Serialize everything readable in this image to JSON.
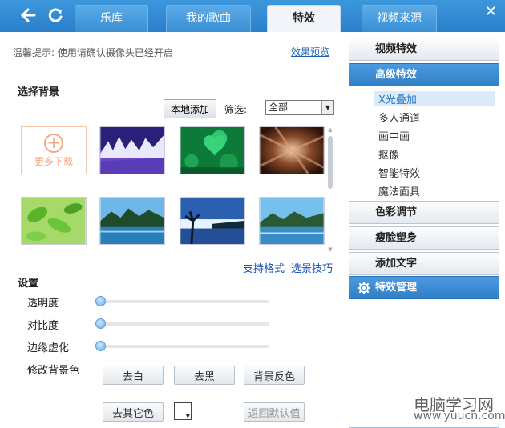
{
  "tabs": [
    {
      "label": "乐库"
    },
    {
      "label": "我的歌曲"
    },
    {
      "label": "特效"
    },
    {
      "label": "视频来源"
    }
  ],
  "icons": {
    "back": "back-arrow-icon",
    "refresh": "refresh-icon",
    "close": "close-icon"
  },
  "tip": "温馨提示: 使用请确认摄像头已经开启",
  "preview_link": "效果预览",
  "background_section": {
    "title": "选择背景",
    "local_add": "本地添加",
    "filter_label": "筛选:",
    "filter_value": "全部",
    "more_download": "更多下载",
    "support_format": "支持格式",
    "bg_tips": "选景技巧"
  },
  "settings": {
    "title": "设置",
    "sliders": [
      {
        "label": "透明度",
        "value": 0
      },
      {
        "label": "对比度",
        "value": 0
      },
      {
        "label": "边缘虚化",
        "value": 0
      }
    ],
    "bg_color_label": "修改背景色",
    "buttons": {
      "remove_white": "去白",
      "remove_black": "去黑",
      "invert_bg": "背景反色",
      "remove_other": "去其它色",
      "restore_default": "返回默认值"
    }
  },
  "right_panel": {
    "video_effects": "视频特效",
    "advanced_effects": "高级特效",
    "advanced_items": [
      "X光叠加",
      "多人通道",
      "画中画",
      "抠像",
      "智能特效",
      "魔法面具"
    ],
    "color_adjust": "色彩调节",
    "face_shaping": "瘦脸塑身",
    "add_text": "添加文字",
    "effects_manager": "特效管理"
  },
  "watermark": {
    "line1": "电脑学习网",
    "line2": "www.yuucn.com"
  },
  "colors": {
    "accent": "#2f80c9",
    "topbar": "#3d97dd",
    "selected_text": "#2a79c7"
  }
}
